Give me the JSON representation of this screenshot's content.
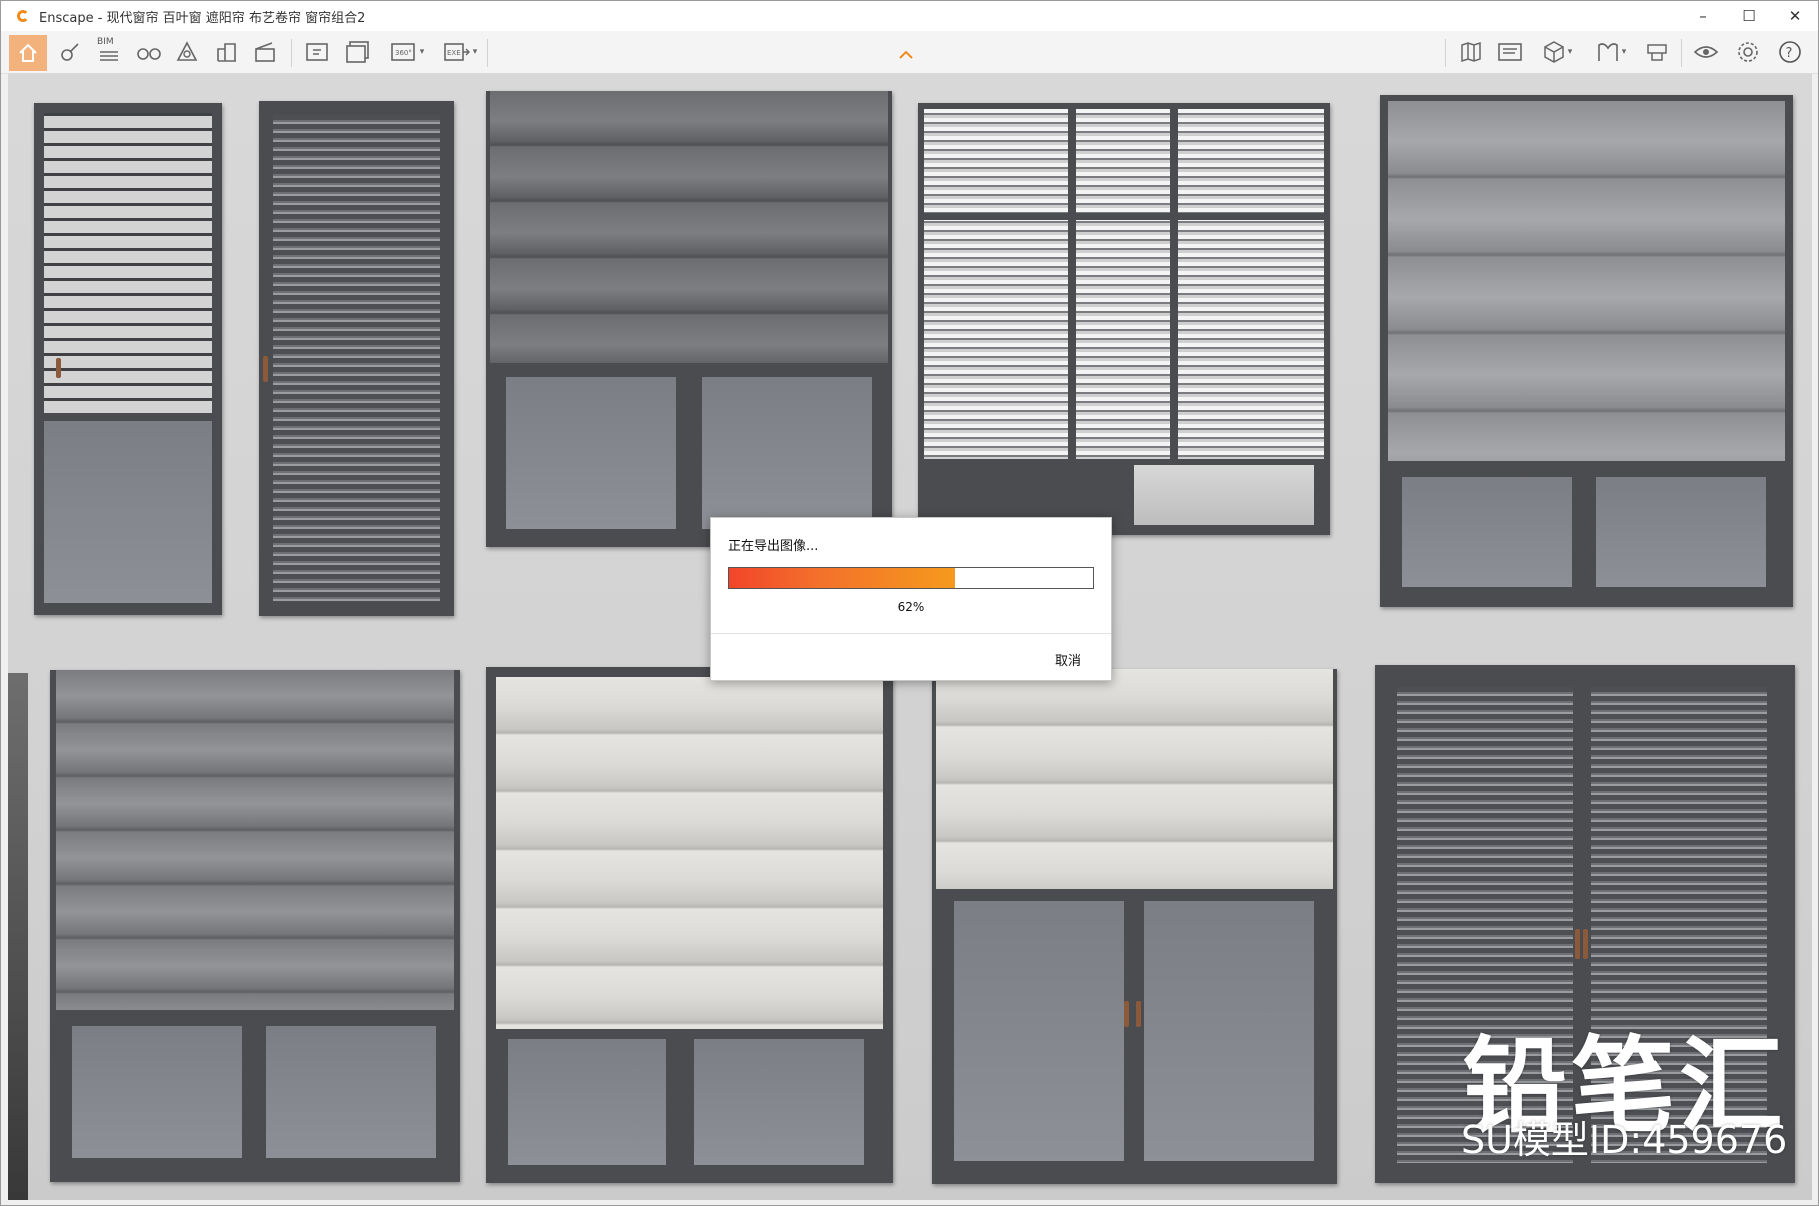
{
  "window": {
    "title": "Enscape - 现代窗帘 百叶窗 遮阳帘 布艺卷帘 窗帘组合2",
    "minimize_label": "–",
    "maximize_label": "☐",
    "close_label": "✕"
  },
  "toolbar": {
    "bim_label": "BIM",
    "items": [
      "home-icon",
      "asset-library-icon",
      "bim-icon",
      "binoculars-icon",
      "atmosphere-icon",
      "buildings-icon",
      "video-editor-icon",
      "screenshot-icon",
      "batch-render-icon",
      "panorama-icon",
      "export-icon",
      "map-icon",
      "web-export-icon",
      "view-cube-icon",
      "material-icon",
      "collaboration-icon",
      "visual-settings-icon",
      "settings-icon",
      "help-icon"
    ],
    "panorama_label": "360°",
    "export_label": "EXE",
    "help_label": "?"
  },
  "export_dialog": {
    "title": "正在导出图像...",
    "progress_percent": 62,
    "progress_text": "62%",
    "cancel_label": "取消"
  },
  "watermark": {
    "brand": "铅笔汇",
    "model_id": "SU模型ID:459676"
  },
  "colors": {
    "accent_orange": "#f28b1d",
    "progress_start": "#f2452a",
    "progress_end": "#f59a1c",
    "frame_dark": "#4a4c50"
  }
}
